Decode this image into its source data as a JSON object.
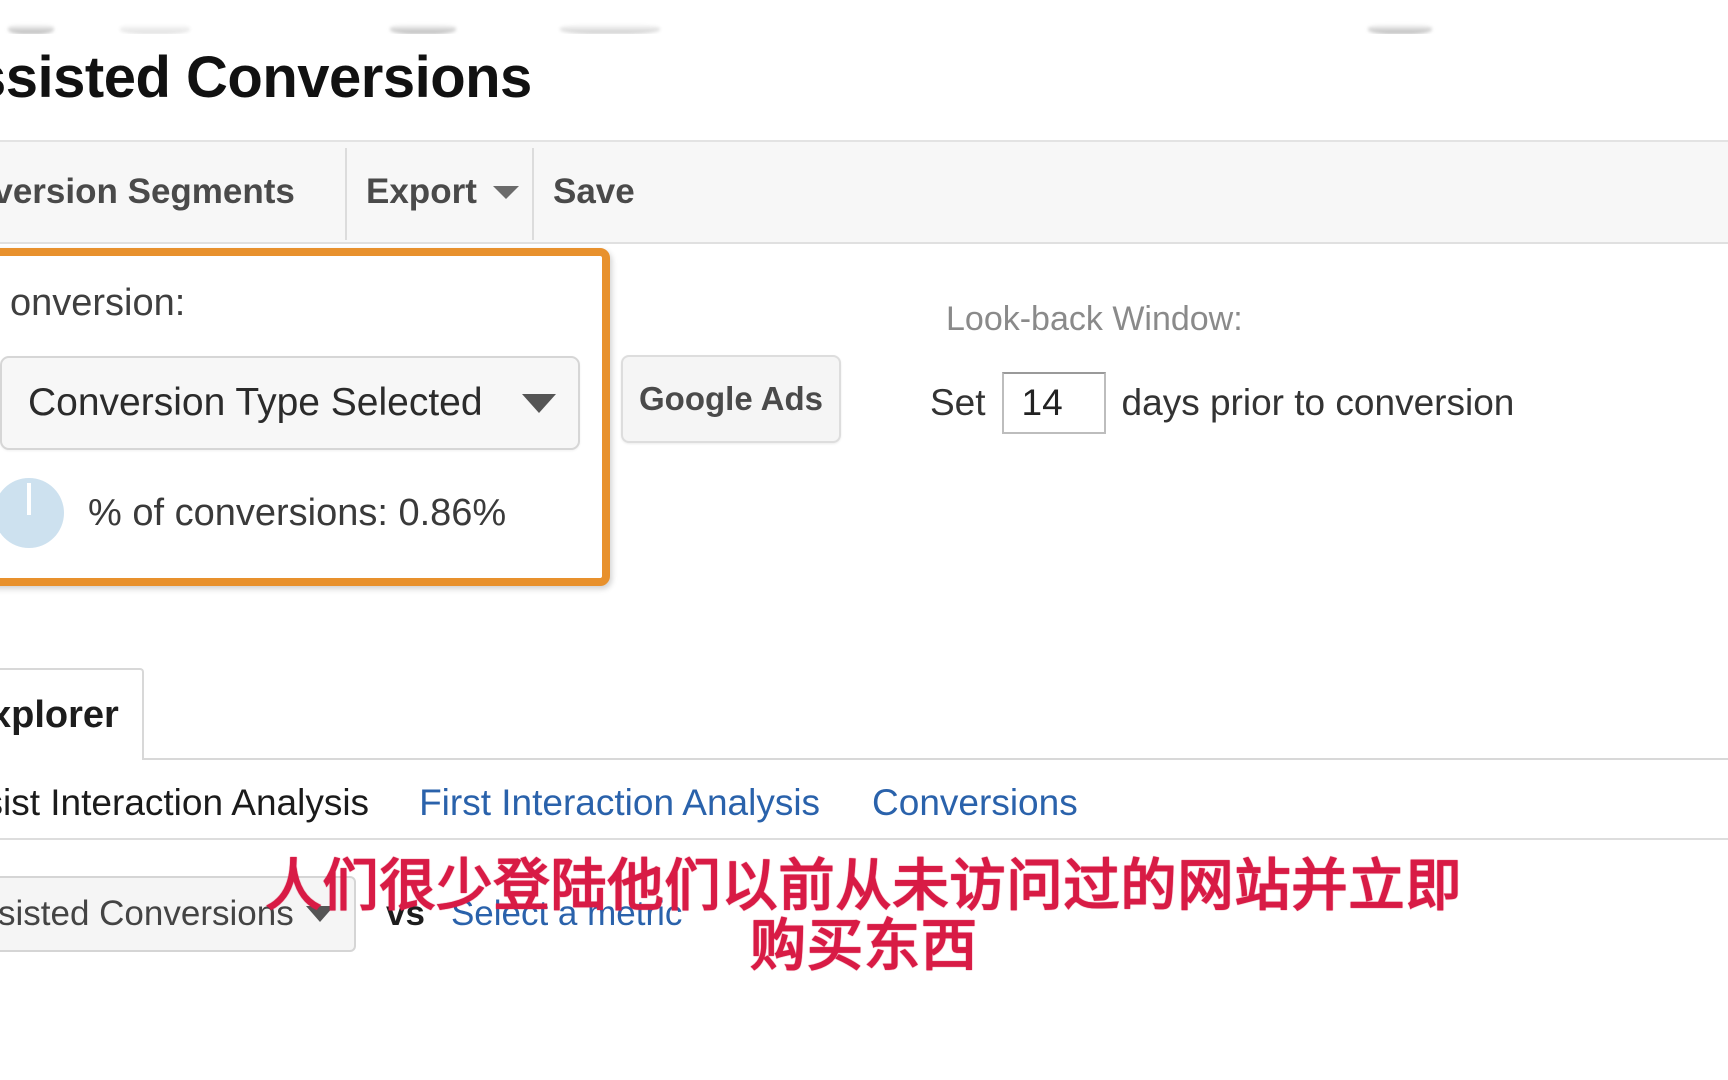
{
  "page": {
    "title": "ssisted Conversions",
    "full_title_hint": "Assisted Conversions"
  },
  "toolbar": {
    "segments_label": "nversion Segments",
    "export_label": "Export",
    "export_caret": "chevron-down-icon",
    "save_label": "Save"
  },
  "highlight_panel": {
    "label": "onversion:",
    "select_value": "Conversion Type Selected",
    "select_caret": "chevron-down-icon",
    "stat_icon": "pie-chart-icon",
    "stat_text": "% of conversions: 0.86%"
  },
  "behind_panel": {
    "hidden_label": ":"
  },
  "channel": {
    "chip_label": "Google Ads"
  },
  "lookback": {
    "label": "Look-back Window:",
    "prefix": "Set",
    "value": "14",
    "suffix": "days prior to conversion"
  },
  "tabs": {
    "active_label": "xplorer"
  },
  "analysis_links": {
    "active": "ssist Interaction Analysis",
    "links": [
      "First Interaction Analysis",
      "Conversions"
    ]
  },
  "metric_row": {
    "selected_metric": "sisted Conversions",
    "select_caret": "chevron-down-icon",
    "vs": "vs",
    "secondary_metric_link": "Select a metric"
  },
  "subtitle": {
    "line1": "人们很少登陆他们以前从未访问过的网站并立即",
    "line2": "购买东西"
  },
  "colors": {
    "highlight_border": "#e8912d",
    "link": "#2a62ab",
    "subtitle": "#d81b45",
    "pie_fill": "#cde1ef",
    "toolbar_bg": "#f7f7f7"
  }
}
